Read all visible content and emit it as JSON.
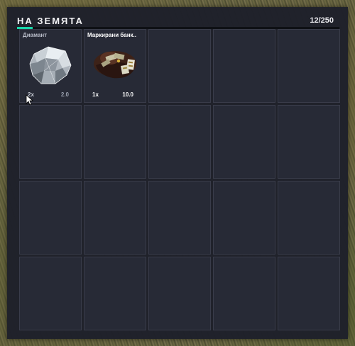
{
  "inventory": {
    "title": "НА ЗЕМЯТА",
    "count": "12/250",
    "weight_fill_fraction": 0.048,
    "accent_color": "#19d6a8",
    "slots": [
      {
        "name": "Диамант",
        "icon": "diamond-icon",
        "qty": "2x",
        "weight": "2.0",
        "name_color": "#b8bcc8",
        "qty_color": "#c8ccd6",
        "weight_color": "#9aa0ae"
      },
      {
        "name": "Маркирани банк..",
        "icon": "money-bag-icon",
        "qty": "1x",
        "weight": "10.0",
        "name_color": "#ffffff",
        "qty_color": "#ffffff",
        "weight_color": "#ffffff"
      },
      {},
      {},
      {},
      {},
      {},
      {},
      {},
      {},
      {},
      {},
      {},
      {},
      {},
      {},
      {},
      {},
      {},
      {}
    ]
  }
}
